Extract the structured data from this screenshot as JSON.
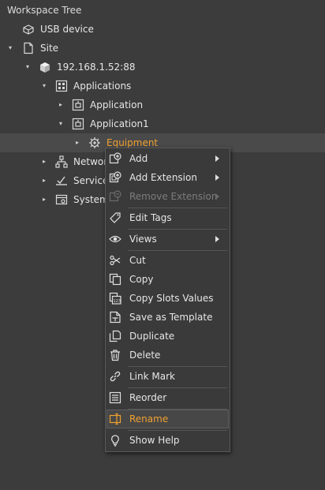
{
  "panel": {
    "title": "Workspace Tree"
  },
  "tree": {
    "usb_device": "USB device",
    "site": "Site",
    "host": "192.168.1.52:88",
    "applications": "Applications",
    "application": "Application",
    "application1": "Application1",
    "equipment": "Equipment",
    "networks": "Networks",
    "services": "Services",
    "system": "System"
  },
  "context_menu": {
    "add": "Add",
    "add_extension": "Add Extension",
    "remove_extension": "Remove Extension",
    "edit_tags": "Edit Tags",
    "views": "Views",
    "cut": "Cut",
    "copy": "Copy",
    "copy_slots_values": "Copy Slots Values",
    "save_as_template": "Save as Template",
    "duplicate": "Duplicate",
    "delete": "Delete",
    "link_mark": "Link Mark",
    "reorder": "Reorder",
    "rename": "Rename",
    "show_help": "Show Help"
  },
  "colors": {
    "accent": "#f0a030",
    "background": "#3c3c3c",
    "menu_bg": "#3a3a3a"
  }
}
